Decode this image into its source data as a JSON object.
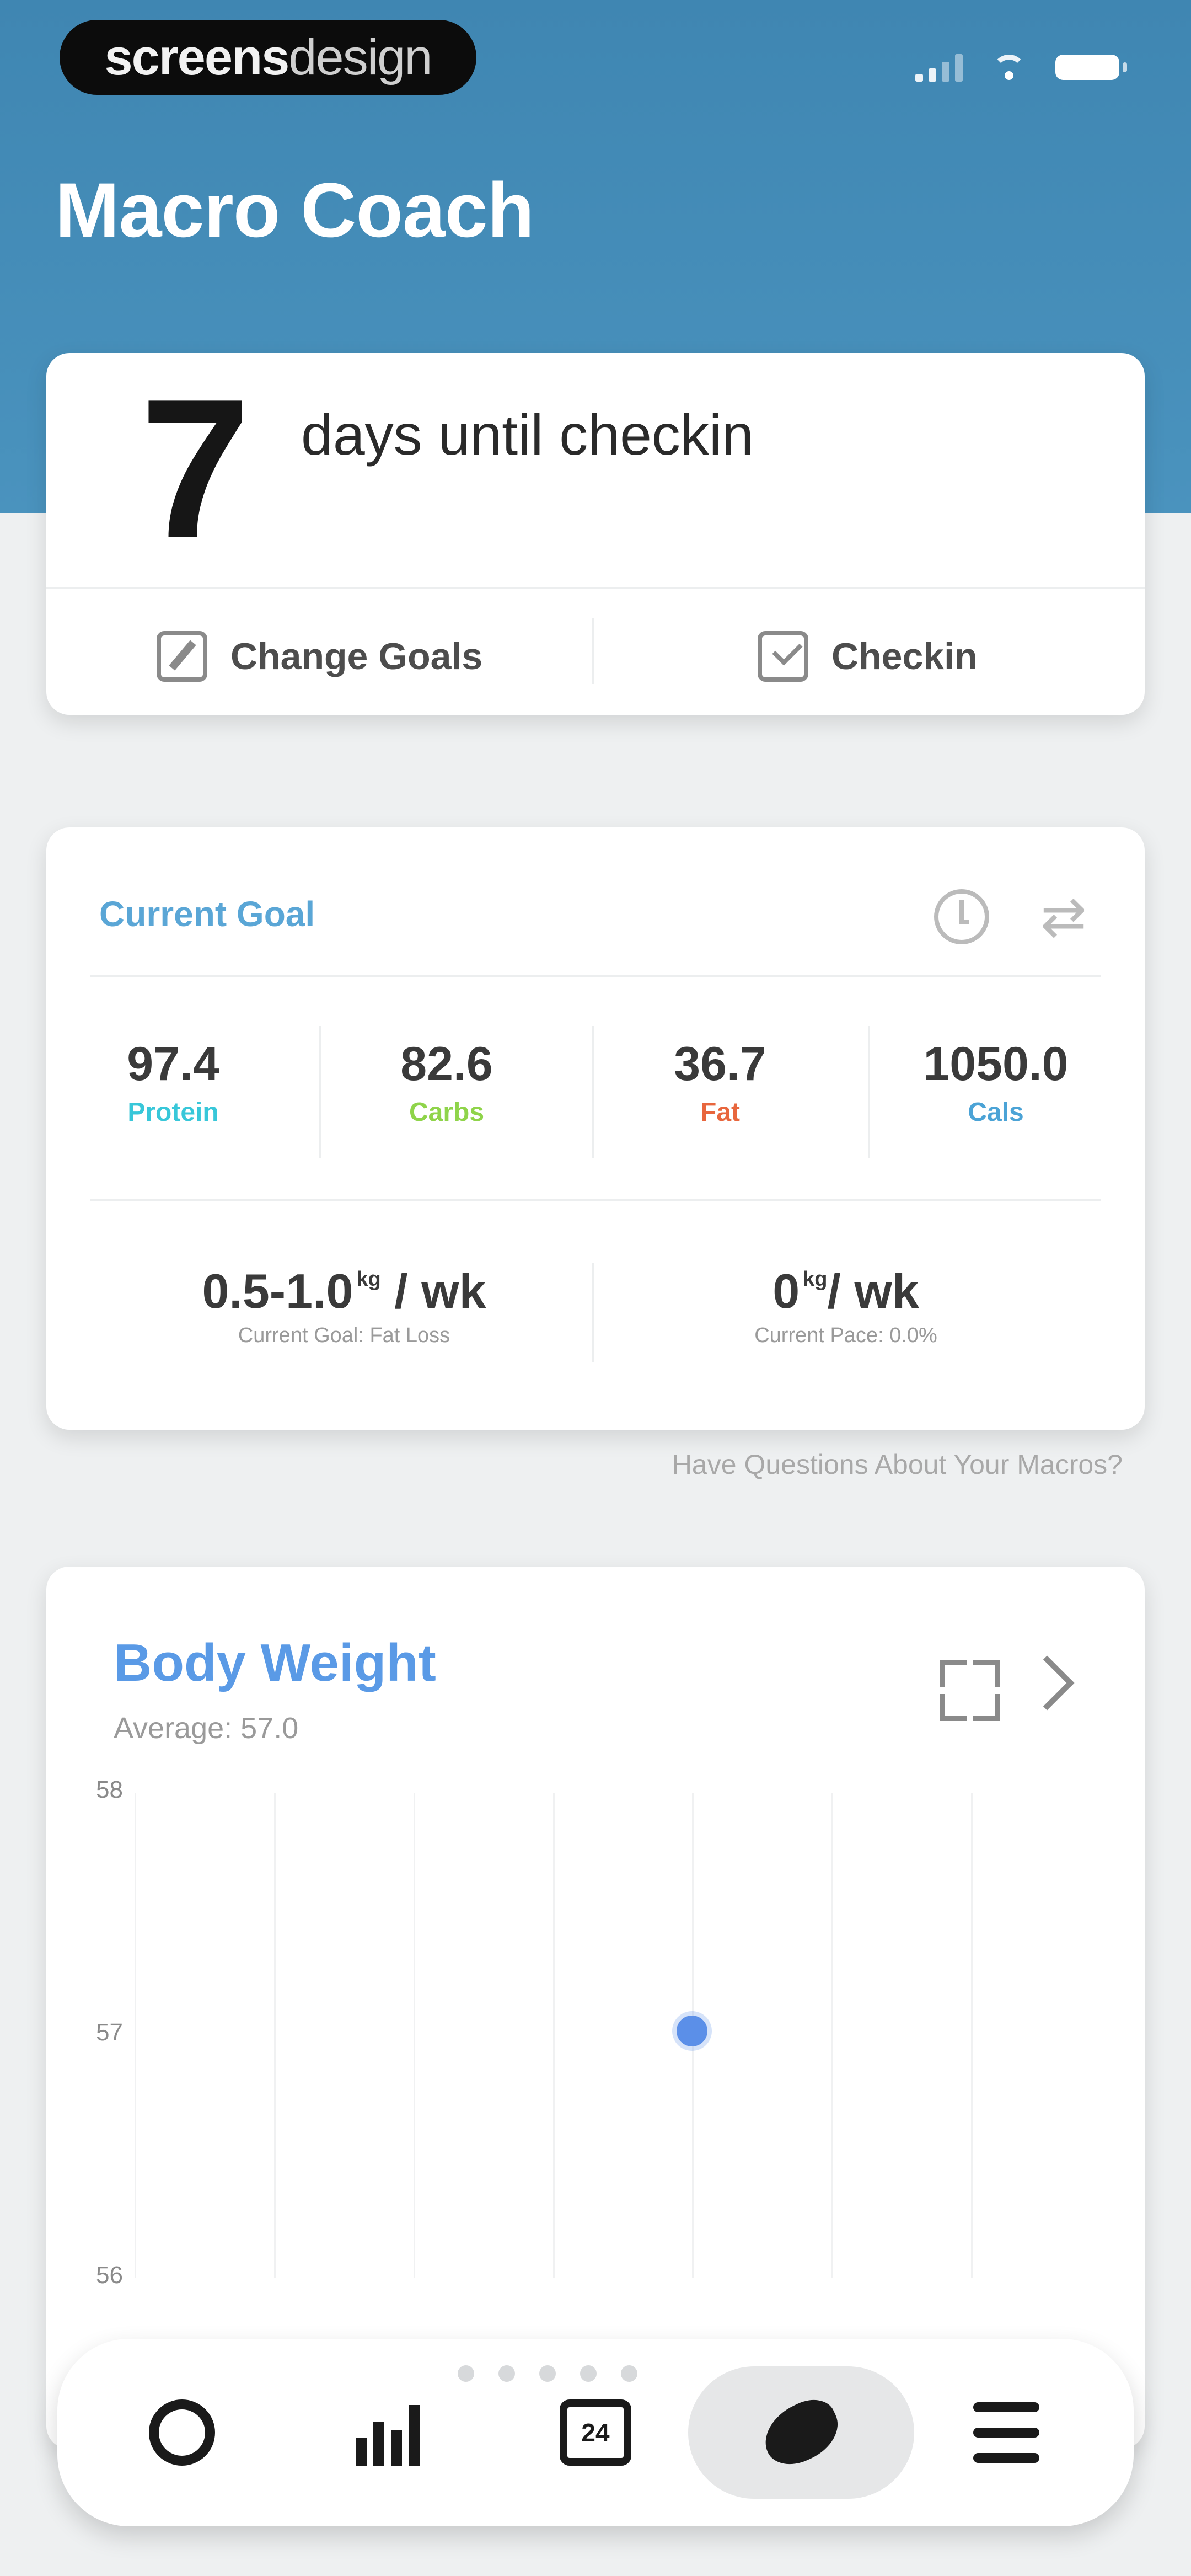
{
  "status_bar": {
    "badge_bold": "screens",
    "badge_light": "design"
  },
  "header": {
    "title": "Macro Coach"
  },
  "checkin_card": {
    "days": "7",
    "days_label": "days until checkin",
    "change_goals_label": "Change Goals",
    "checkin_label": "Checkin"
  },
  "goal_card": {
    "title": "Current Goal",
    "macros": [
      {
        "value": "97.4",
        "label": "Protein",
        "color": "#38c7d9"
      },
      {
        "value": "82.6",
        "label": "Carbs",
        "color": "#8fd44a"
      },
      {
        "value": "36.7",
        "label": "Fat",
        "color": "#e8663d"
      },
      {
        "value": "1050.0",
        "label": "Cals",
        "color": "#4ba3d6"
      }
    ],
    "goal_rate": "0.5-1.0",
    "goal_rate_unit": "kg",
    "goal_rate_suffix": "/ wk",
    "goal_rate_sub": "Current Goal: Fat Loss",
    "pace_rate": "0",
    "pace_rate_unit": "kg",
    "pace_rate_suffix": "/ wk",
    "pace_rate_sub": "Current Pace: 0.0%"
  },
  "questions_link": "Have Questions About Your Macros?",
  "weight_card": {
    "title": "Body Weight",
    "average": "Average: 57.0"
  },
  "chart_data": {
    "type": "scatter",
    "title": "Body Weight",
    "ylim": [
      56,
      58
    ],
    "yticks": [
      "58",
      "57",
      "56"
    ],
    "x": [
      4
    ],
    "y": [
      57.0
    ],
    "grid": "vertical",
    "color": "#5b8fe8"
  },
  "tabbar": {
    "items": [
      "recycle-icon",
      "stats-icon",
      "calendar-icon",
      "food-icon",
      "settings-icon"
    ],
    "active_index": 3,
    "calendar_day": "24",
    "page_dots": 5
  }
}
